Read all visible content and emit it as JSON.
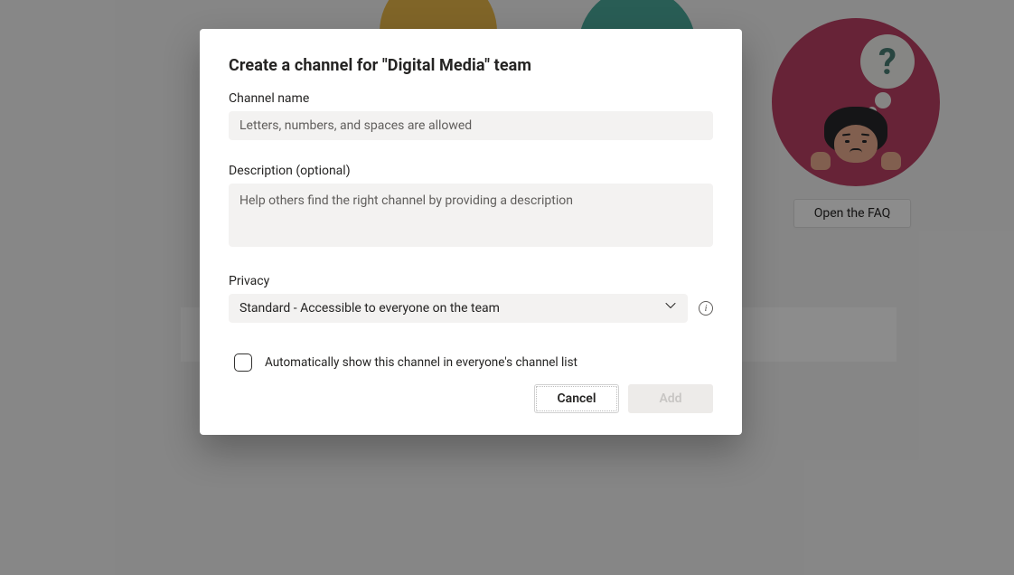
{
  "modal": {
    "title": "Create a channel for \"Digital Media\" team",
    "channel_name": {
      "label": "Channel name",
      "placeholder": "Letters, numbers, and spaces are allowed",
      "value": ""
    },
    "description": {
      "label": "Description (optional)",
      "placeholder": "Help others find the right channel by providing a description",
      "value": ""
    },
    "privacy": {
      "label": "Privacy",
      "selected": "Standard - Accessible to everyone on the team"
    },
    "auto_show": {
      "label": "Automatically show this channel in everyone's channel list",
      "checked": false
    },
    "buttons": {
      "cancel": "Cancel",
      "add": "Add"
    }
  },
  "faq": {
    "button_label": "Open the FAQ",
    "icon_glyph": "?"
  }
}
